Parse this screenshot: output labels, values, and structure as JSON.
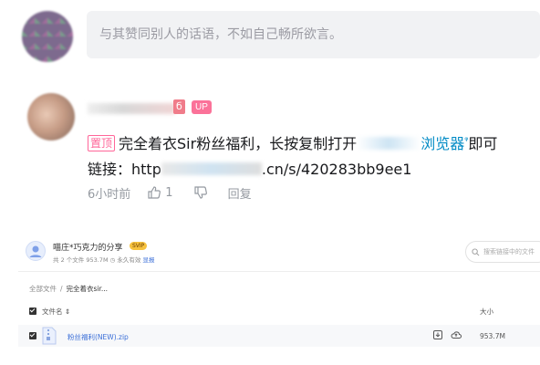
{
  "comment_input": {
    "placeholder": "与其赞同别人的话语，不如自己畅所欲言。"
  },
  "comment": {
    "user_suffix": "б",
    "up_badge": "UP",
    "pin_label": "置顶",
    "text_part1": "完全着衣Sir粉丝福利，长按复制打开",
    "text_link": "浏览器",
    "search_mark": "ᵠ",
    "text_part2": "即可",
    "line2_prefix": "链接：http",
    "line2_suffix": ".cn/s/420283bb9ee1",
    "time": "6小时前",
    "like_count": "1",
    "reply_label": "回复"
  },
  "share": {
    "title": "喵庄*巧克力的分享",
    "badge": "SVIP",
    "info": "共 2 个文件 953.7M",
    "validity": "永久有效",
    "save_label": "显报",
    "search_placeholder": "搜索链接中的文件",
    "breadcrumb": {
      "root": "全部文件",
      "sep": "/",
      "current": "完全着衣sir..."
    },
    "columns": {
      "name": "文件名 ⇕",
      "size": "大小"
    },
    "files": [
      {
        "name": "粉丝福利(NEW).zip",
        "size": "953.7M"
      }
    ]
  },
  "colors": {
    "pin_border": "#ff6699",
    "up_badge": "#fb7299",
    "link_blue": "#008ac5",
    "meta_gray": "#9499a0",
    "share_link": "#3b6fd8"
  },
  "icons": {
    "like": "thumbs-up-icon",
    "dislike": "thumbs-down-icon",
    "download": "download-icon",
    "save_to_cloud": "cloud-save-icon",
    "search": "search-icon"
  }
}
